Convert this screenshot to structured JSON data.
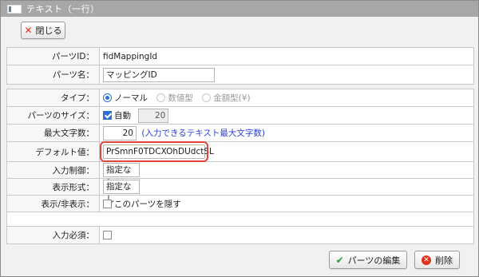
{
  "window": {
    "title": "テキスト（一行）"
  },
  "toolbar": {
    "close_label": "閉じる"
  },
  "info": {
    "parts_id_label": "パーツID：",
    "parts_id_value": "fidMappingId",
    "parts_name_label": "パーツ名：",
    "parts_name_value": "マッピングID"
  },
  "settings": {
    "type_label": "タイプ：",
    "type_options": [
      "ノーマル",
      "数値型",
      "金額型(¥)"
    ],
    "type_selected": "ノーマル",
    "size_label": "パーツのサイズ：",
    "size_auto_label": "自動",
    "size_auto_checked": true,
    "size_value": "20",
    "maxlen_label": "最大文字数：",
    "maxlen_value": "20",
    "maxlen_hint": "(入力できるテキスト最大文字数)",
    "default_label": "デフォルト値：",
    "default_value": "PrSmnF0TDCXOhDUdctSL",
    "input_control_label": "入力制御：",
    "input_control_value": "指定なし",
    "display_format_label": "表示形式：",
    "display_format_value": "指定なし",
    "visibility_label": "表示/非表示：",
    "visibility_option": "このパーツを隠す",
    "visibility_checked": false
  },
  "required": {
    "label": "入力必須：",
    "checked": false
  },
  "footer": {
    "edit_label": "パーツの編集",
    "delete_label": "削除"
  }
}
